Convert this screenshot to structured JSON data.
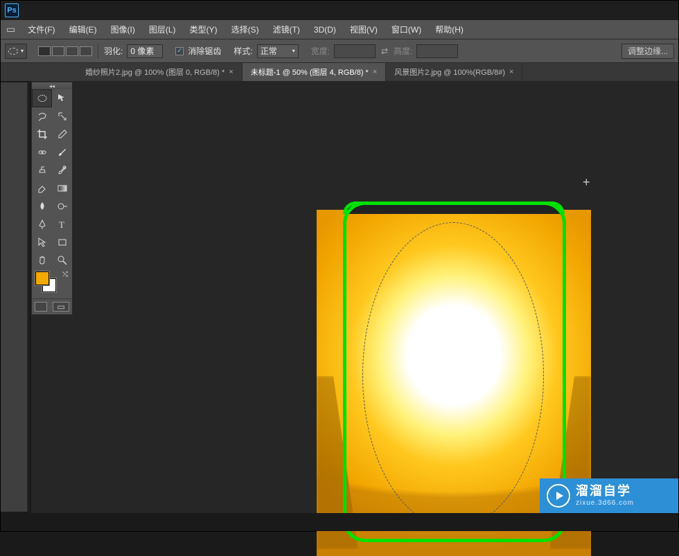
{
  "menus": [
    "文件(F)",
    "编辑(E)",
    "图像(I)",
    "图层(L)",
    "类型(Y)",
    "选择(S)",
    "滤镜(T)",
    "3D(D)",
    "视图(V)",
    "窗口(W)",
    "帮助(H)"
  ],
  "optionbar": {
    "feather_label": "羽化:",
    "feather_value": "0 像素",
    "antialias_checked": true,
    "antialias_label": "消除锯齿",
    "style_label": "样式:",
    "style_value": "正常",
    "width_label": "宽度:",
    "height_label": "高度:",
    "refine_edge": "调整边缘..."
  },
  "tabs": [
    {
      "label": "婚纱照片2.jpg @ 100% (图层 0, RGB/8) *",
      "active": false
    },
    {
      "label": "未标题-1 @ 50% (图层 4, RGB/8) *",
      "active": true
    },
    {
      "label": "风景图片2.jpg @ 100%(RGB/8#)",
      "active": false
    }
  ],
  "colors": {
    "foreground": "#f2a900",
    "background": "#ffffff"
  },
  "watermark": {
    "brand": "溜溜自学",
    "domain": "zixue.3d66.com"
  }
}
